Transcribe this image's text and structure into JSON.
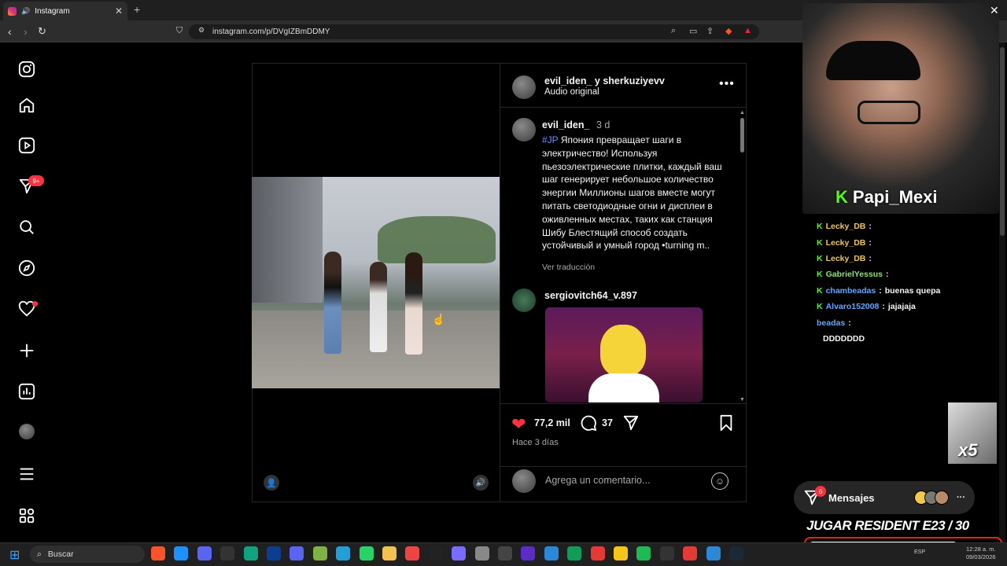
{
  "browser": {
    "tab_title": "Instagram",
    "new_tab": "+",
    "tab_close": "✕",
    "url": "instagram.com/p/DVgIZBmDDMY"
  },
  "sidebar": {
    "notifications_badge": "9+"
  },
  "post": {
    "header_user": "evil_iden_ y sherkuziyevv",
    "header_sub": "Audio original",
    "caption_user": "evil_iden_",
    "caption_time": "3 d",
    "caption_tag": "#JP",
    "caption_text": "Япония превращает шаги в электричество! Используя пьезоэлектрические плитки, каждый ваш шаг генерирует небольшое количество энергии Миллионы шагов вместе могут питать светодиодные огни и дисплеи в оживленных местах, таких как станция Шибу Блестящий способ создать устойчивый и умный город •turning m..",
    "translate": "Ver traducción",
    "comment_user": "sergiovitch64_v.897",
    "likes": "77,2 mil",
    "comments": "37",
    "time_ago": "Hace 3 días",
    "comment_placeholder": "Agrega un comentario..."
  },
  "stream": {
    "streamer": "Papi_Mexi",
    "chat": [
      {
        "user": "Lecky_DB",
        "sep": ":",
        "msg": "",
        "color": "#f3c74a"
      },
      {
        "user": "Lecky_DB",
        "sep": ":",
        "msg": "",
        "color": "#f3c74a"
      },
      {
        "user": "Lecky_DB",
        "sep": ":",
        "msg": "",
        "color": "#f3c74a"
      },
      {
        "user": "GabrielYessus",
        "sep": ":",
        "msg": "",
        "color": "#8be36b"
      },
      {
        "user": "chambeadas",
        "sep": ":",
        "msg": "buenas quepa",
        "color": "#5fa8ff"
      },
      {
        "user": "Alvaro152008",
        "sep": ":",
        "msg": "jajajaja",
        "color": "#5fa8ff"
      },
      {
        "user": "beadas",
        "sep": ":",
        "msg": "",
        "color": "#5fa8ff"
      },
      {
        "user": "",
        "sep": "",
        "msg": "DDDDDDD",
        "color": "#fff"
      }
    ],
    "sticker_text": "x5",
    "messages_label": "Mensajes",
    "messages_badge": "6",
    "messages_more": "···",
    "goal_text": "JUGAR RESIDENT E23  / 30",
    "goal_progress": 0.77
  },
  "taskbar": {
    "search_placeholder": "Buscar",
    "lang": "ESP",
    "time": "12:28 a. m.",
    "date": "09/03/2026"
  },
  "colors": {
    "accent_red": "#ff3040",
    "kick_green": "#53fc18",
    "link_blue": "#6a8fff"
  }
}
